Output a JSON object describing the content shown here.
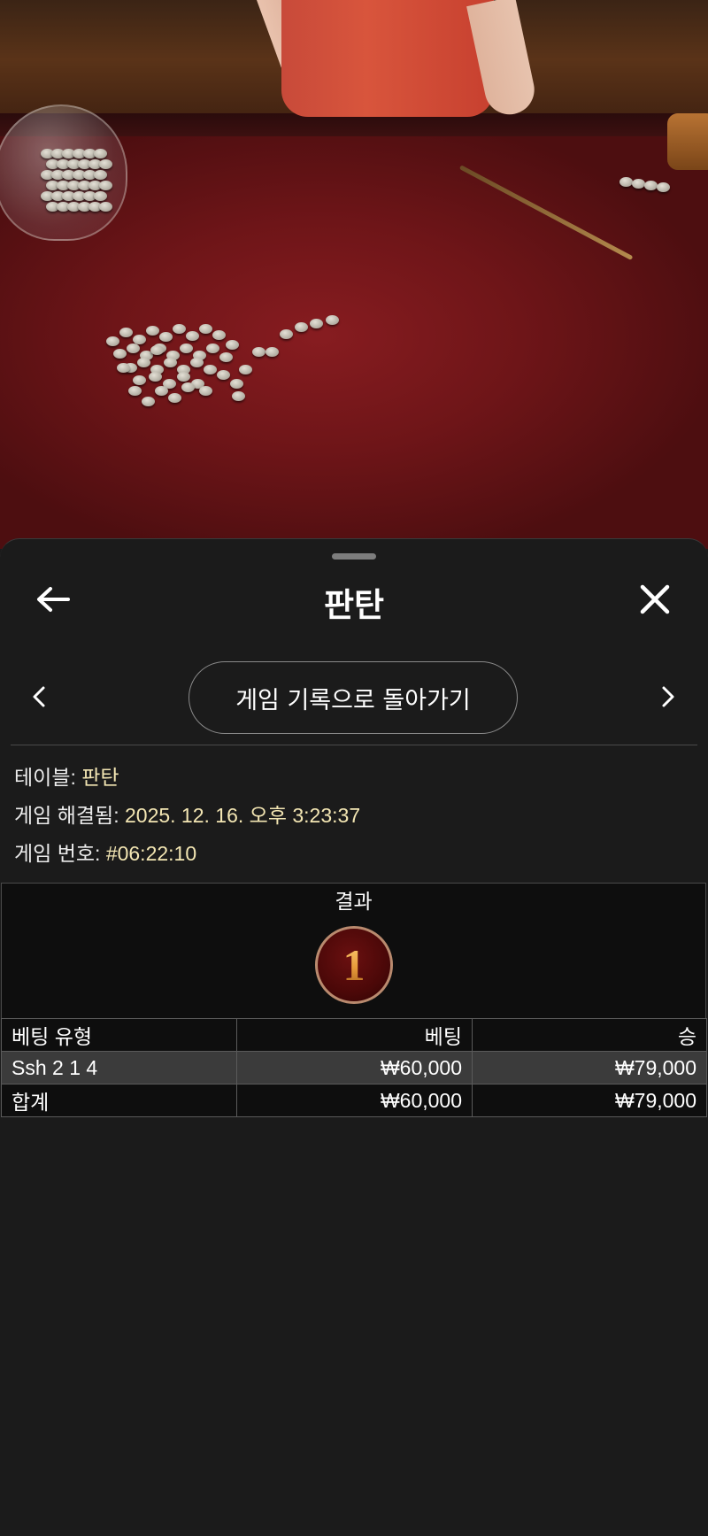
{
  "video": {
    "scene": "live-dealer-fantan-table"
  },
  "sheet": {
    "title": "판탄",
    "back_icon": "arrow-left-icon",
    "close_icon": "close-icon",
    "prev_icon": "chevron-left-icon",
    "next_icon": "chevron-right-icon",
    "history_button_label": "게임 기록으로 돌아가기"
  },
  "info": {
    "table_label": "테이블:",
    "table_value": "판탄",
    "resolved_label": "게임 해결됨:",
    "resolved_value": "2025. 12. 16. 오후 3:23:37",
    "round_label": "게임 번호:",
    "round_value": "#06:22:10"
  },
  "result": {
    "header": "결과",
    "value": "1"
  },
  "bets_table": {
    "headers": [
      "베팅 유형",
      "베팅",
      "승"
    ],
    "rows": [
      {
        "type": "Ssh 2 1 4",
        "bet": "₩60,000",
        "win": "₩79,000"
      }
    ],
    "total": {
      "label": "합계",
      "bet": "₩60,000",
      "win": "₩79,000"
    }
  },
  "colors": {
    "sheet_bg": "#1b1b1b",
    "info_value": "#f3e6b3",
    "result_ball": "#4b0808",
    "result_numeral": "#e9a24c",
    "highlight_row": "#3b3b3b"
  }
}
